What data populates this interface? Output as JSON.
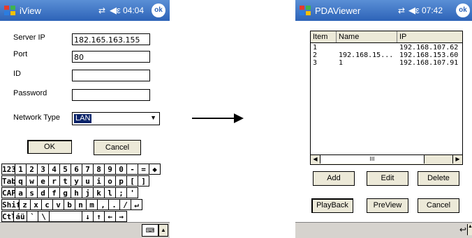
{
  "left": {
    "title": "iView",
    "signal_icon": "⇄",
    "speaker_icon": "◀ε",
    "clock": "04:04",
    "ok": "ok",
    "form": {
      "server_ip_label": "Server IP",
      "server_ip_value": "182.165.163.155",
      "port_label": "Port",
      "port_value": "80",
      "id_label": "ID",
      "id_value": "",
      "password_label": "Password",
      "password_value": "",
      "network_type_label": "Network Type",
      "network_type_value": "LAN"
    },
    "ok_button": "OK",
    "cancel_button": "Cancel",
    "keyboard": {
      "rows": [
        [
          "123",
          "1",
          "2",
          "3",
          "4",
          "5",
          "6",
          "7",
          "8",
          "9",
          "0",
          "-",
          "=",
          "◆"
        ],
        [
          "Tab",
          "q",
          "w",
          "e",
          "r",
          "t",
          "y",
          "u",
          "i",
          "o",
          "p",
          "[",
          "]"
        ],
        [
          "CAP",
          "a",
          "s",
          "d",
          "f",
          "g",
          "h",
          "j",
          "k",
          "l",
          ";",
          "'"
        ],
        [
          "Shift",
          "z",
          "x",
          "c",
          "v",
          "b",
          "n",
          "m",
          ",",
          ".",
          "/",
          "↵"
        ],
        [
          "Ctl",
          "áü",
          "`",
          "\\",
          " ",
          "↓",
          "↑",
          "←",
          "→"
        ]
      ]
    },
    "kb_icon": "⌨",
    "kb_up": "▲"
  },
  "right": {
    "title": "PDAViewer",
    "signal_icon": "⇄",
    "speaker_icon": "◀ε",
    "clock": "07:42",
    "ok": "ok",
    "list": {
      "columns": [
        "Item",
        "Name",
        "IP"
      ],
      "rows": [
        {
          "item": "1",
          "name": "",
          "ip": "192.168.107.62"
        },
        {
          "item": "2",
          "name": "192.168.15...",
          "ip": "192.168.153.60"
        },
        {
          "item": "3",
          "name": "1",
          "ip": "192.168.107.91"
        }
      ],
      "scroll_left": "◀",
      "scroll_thumb": "III",
      "scroll_right": "▶"
    },
    "buttons": {
      "add": "Add",
      "edit": "Edit",
      "delete": "Delete",
      "playback": "PlayBack",
      "preview": "PreView",
      "cancel": "Cancel"
    },
    "undo_icon": "↩",
    "up_icon": "▲"
  },
  "colors": {
    "titlebar_top": "#5a8fd6",
    "titlebar_bottom": "#2d63b8",
    "selection": "#0a246a",
    "button_face": "#ece9d8",
    "taskbar": "#d6d3ce"
  }
}
